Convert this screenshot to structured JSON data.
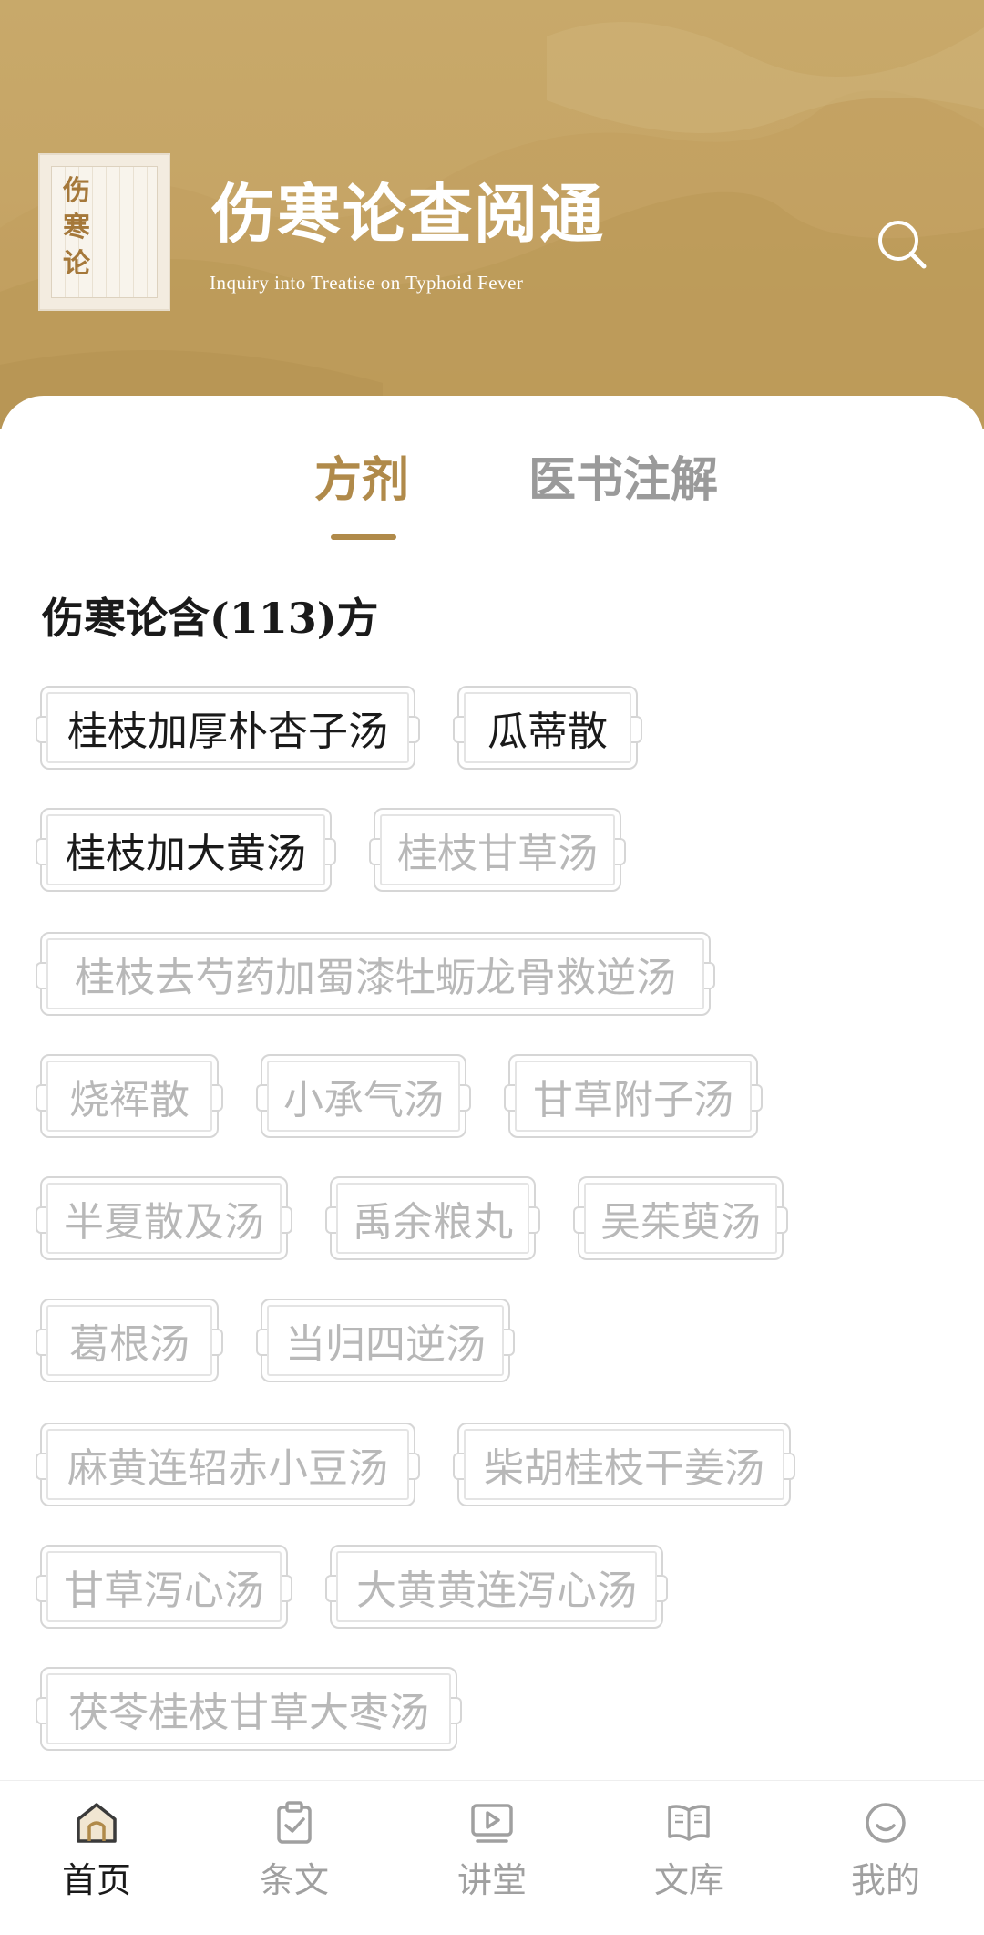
{
  "header": {
    "logo_glyphs": [
      "伤",
      "寒",
      "论"
    ],
    "title": "伤寒论查阅通",
    "subtitle": "Inquiry into Treatise on Typhoid Fever",
    "search_icon": "search-icon"
  },
  "tabs": [
    {
      "label": "方剂",
      "active": true
    },
    {
      "label": "医书注解",
      "active": false
    }
  ],
  "section_heading": "伤寒论含(113)方",
  "formulas": [
    {
      "name": "桂枝加厚朴杏子汤",
      "highlighted": true
    },
    {
      "name": "瓜蒂散",
      "highlighted": true
    },
    {
      "name": "桂枝加大黄汤",
      "highlighted": true
    },
    {
      "name": "桂枝甘草汤",
      "highlighted": false
    },
    {
      "name": "桂枝去芍药加蜀漆牡蛎龙骨救逆汤",
      "highlighted": false
    },
    {
      "name": "烧裈散",
      "highlighted": false
    },
    {
      "name": "小承气汤",
      "highlighted": false
    },
    {
      "name": "甘草附子汤",
      "highlighted": false
    },
    {
      "name": "半夏散及汤",
      "highlighted": false
    },
    {
      "name": "禹余粮丸",
      "highlighted": false
    },
    {
      "name": "吴茱萸汤",
      "highlighted": false
    },
    {
      "name": "葛根汤",
      "highlighted": false
    },
    {
      "name": "当归四逆汤",
      "highlighted": false
    },
    {
      "name": "麻黄连轺赤小豆汤",
      "highlighted": false
    },
    {
      "name": "柴胡桂枝干姜汤",
      "highlighted": false
    },
    {
      "name": "甘草泻心汤",
      "highlighted": false
    },
    {
      "name": "大黄黄连泻心汤",
      "highlighted": false
    },
    {
      "name": "茯苓桂枝甘草大枣汤",
      "highlighted": false
    }
  ],
  "bottom_nav": [
    {
      "label": "首页",
      "icon": "home-icon",
      "active": true
    },
    {
      "label": "条文",
      "icon": "clipboard-check-icon",
      "active": false
    },
    {
      "label": "讲堂",
      "icon": "video-play-icon",
      "active": false
    },
    {
      "label": "文库",
      "icon": "open-book-icon",
      "active": false
    },
    {
      "label": "我的",
      "icon": "smiley-icon",
      "active": false
    }
  ],
  "colors": {
    "accent": "#b08a4a",
    "header_bg": "#c6a566",
    "chip_text_highlighted": "#1a1a1a",
    "chip_text_muted": "#b8b8b8"
  }
}
